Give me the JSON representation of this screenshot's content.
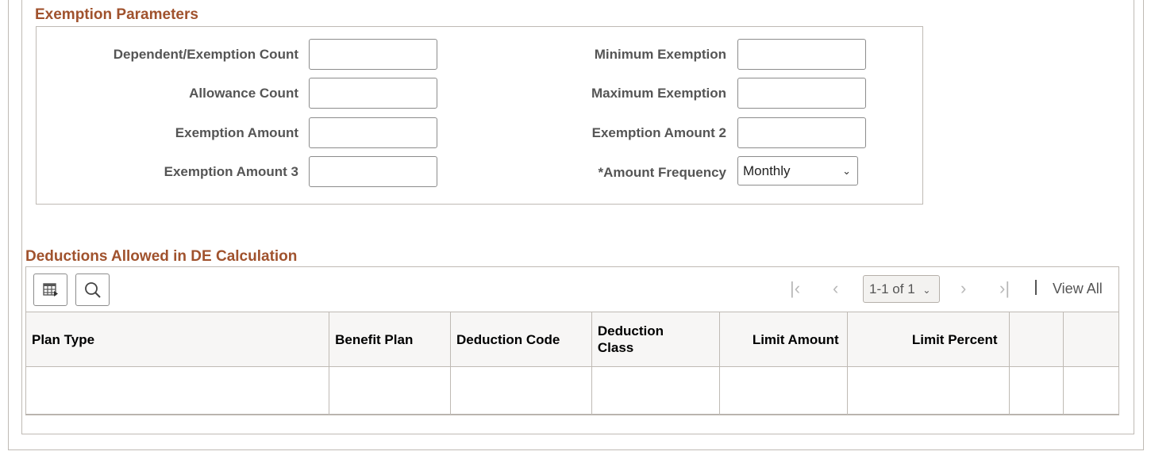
{
  "exemption_parameters": {
    "title": "Exemption Parameters",
    "fields_left": [
      {
        "label": "Dependent/Exemption Count",
        "value": ""
      },
      {
        "label": "Allowance Count",
        "value": ""
      },
      {
        "label": "Exemption Amount",
        "value": ""
      },
      {
        "label": "Exemption Amount 3",
        "value": ""
      }
    ],
    "fields_right": [
      {
        "label": "Minimum Exemption",
        "value": ""
      },
      {
        "label": "Maximum Exemption",
        "value": ""
      },
      {
        "label": "Exemption Amount 2",
        "value": ""
      }
    ],
    "amount_frequency": {
      "label": "*Amount Frequency",
      "value": "Monthly"
    }
  },
  "deductions": {
    "title": "Deductions Allowed in DE Calculation",
    "toolbar": {
      "personalize_icon": "grid-settings-icon",
      "search_icon": "search-icon"
    },
    "pager": {
      "range": "1-1 of 1",
      "view_all": "View All"
    },
    "columns": [
      "Plan Type",
      "Benefit Plan",
      "Deduction Code",
      "Deduction Class",
      "Limit Amount",
      "Limit Percent",
      "",
      ""
    ],
    "rows": [
      [
        "",
        "",
        "",
        "",
        "",
        "",
        "",
        ""
      ]
    ]
  }
}
